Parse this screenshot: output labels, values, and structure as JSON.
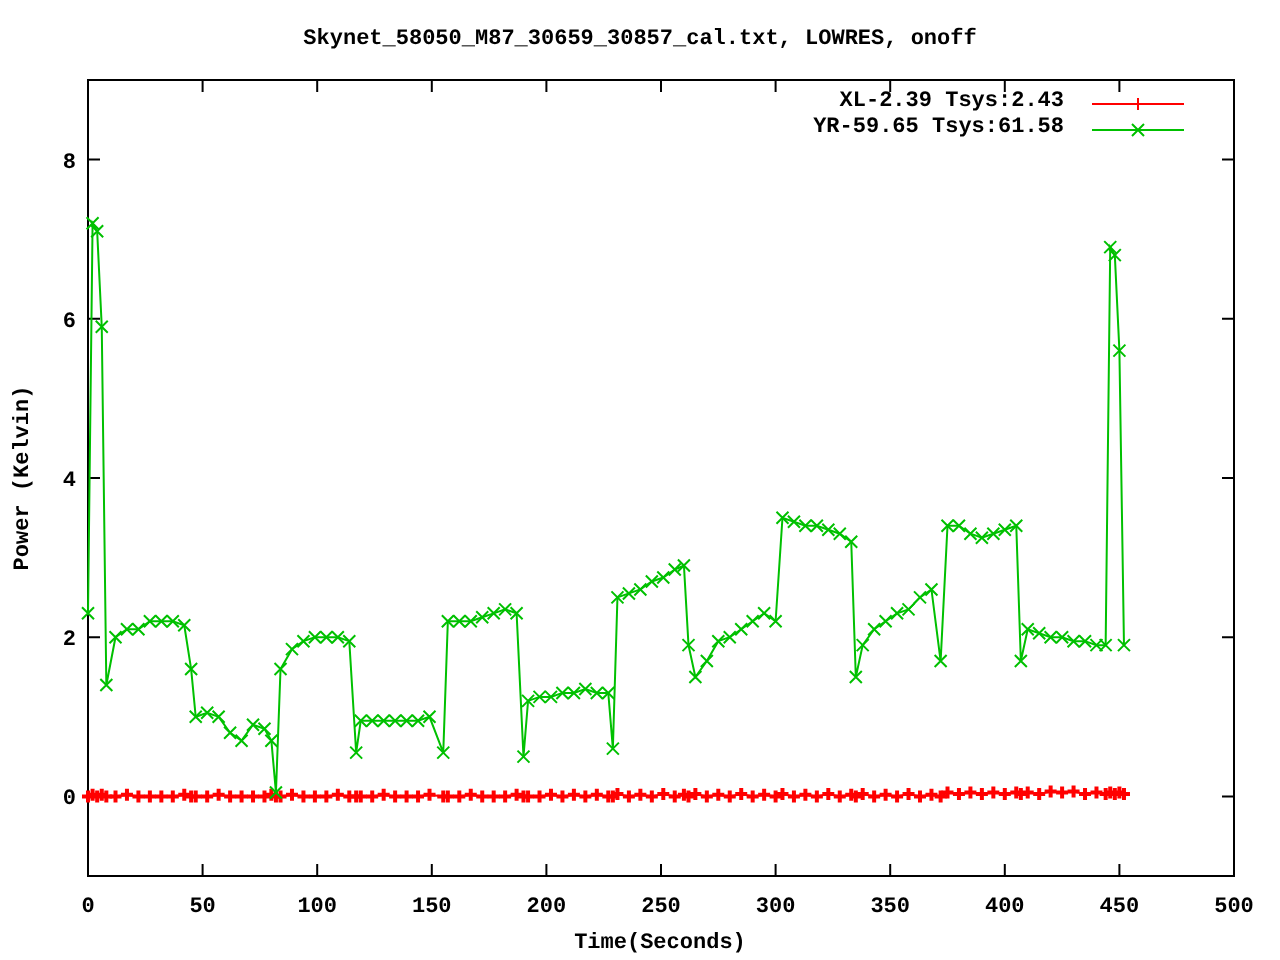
{
  "chart_data": {
    "type": "line",
    "title": "Skynet_58050_M87_30659_30857_cal.txt, LOWRES, onoff",
    "xlabel": "Time(Seconds)",
    "ylabel": "Power (Kelvin)",
    "xlim": [
      0,
      500
    ],
    "ylim": [
      -1,
      9
    ],
    "xticks": [
      0,
      50,
      100,
      150,
      200,
      250,
      300,
      350,
      400,
      450,
      500
    ],
    "yticks": [
      0,
      2,
      4,
      6,
      8
    ],
    "x": [
      0,
      2,
      4,
      6,
      8,
      12,
      17,
      22,
      27,
      32,
      37,
      42,
      45,
      47,
      52,
      57,
      62,
      67,
      72,
      77,
      80,
      82,
      84,
      89,
      94,
      99,
      104,
      109,
      114,
      117,
      119,
      124,
      129,
      134,
      139,
      144,
      149,
      155,
      157,
      162,
      167,
      172,
      177,
      182,
      187,
      190,
      192,
      197,
      202,
      207,
      212,
      217,
      222,
      227,
      229,
      231,
      236,
      241,
      246,
      251,
      256,
      260,
      262,
      265,
      270,
      275,
      280,
      285,
      290,
      295,
      300,
      303,
      308,
      313,
      318,
      323,
      328,
      333,
      335,
      338,
      343,
      348,
      353,
      358,
      363,
      368,
      372,
      375,
      380,
      385,
      390,
      395,
      400,
      405,
      407,
      410,
      415,
      420,
      425,
      430,
      435,
      440,
      444,
      446,
      448,
      450,
      452
    ],
    "series": [
      {
        "name": "XL-2.39 Tsys:2.43",
        "color": "#ff0000",
        "marker": "plus",
        "values": [
          0,
          0.02,
          0,
          0.02,
          0,
          0,
          0.02,
          0,
          0,
          0,
          0,
          0.02,
          0,
          0,
          0,
          0.02,
          0,
          0,
          0,
          0,
          0.02,
          0,
          0,
          0.02,
          0,
          0,
          0,
          0.02,
          0,
          0,
          0,
          0,
          0.02,
          0,
          0,
          0,
          0.02,
          0,
          0,
          0,
          0.02,
          0,
          0,
          0,
          0.02,
          0,
          0,
          0,
          0.02,
          0,
          0.02,
          0,
          0.02,
          0,
          0,
          0.03,
          0,
          0.02,
          0,
          0.03,
          0,
          0.02,
          0,
          0.03,
          0,
          0.02,
          0,
          0.03,
          0,
          0.02,
          0,
          0.03,
          0,
          0.02,
          0,
          0.03,
          0,
          0.02,
          0,
          0.03,
          0,
          0.02,
          0,
          0.03,
          0,
          0.02,
          0,
          0.05,
          0.03,
          0.05,
          0.03,
          0.05,
          0.03,
          0.05,
          0.03,
          0.05,
          0.03,
          0.06,
          0.05,
          0.06,
          0.03,
          0.05,
          0.03,
          0.05,
          0.03,
          0.05,
          0.03
        ]
      },
      {
        "name": "YR-59.65 Tsys:61.58",
        "color": "#00c000",
        "marker": "cross",
        "values": [
          2.3,
          7.2,
          7.1,
          5.9,
          1.4,
          2.0,
          2.1,
          2.1,
          2.2,
          2.2,
          2.2,
          2.15,
          1.6,
          1.0,
          1.05,
          1.0,
          0.8,
          0.7,
          0.9,
          0.85,
          0.7,
          0.05,
          1.6,
          1.85,
          1.95,
          2.0,
          2.0,
          2.0,
          1.95,
          0.55,
          0.95,
          0.95,
          0.95,
          0.95,
          0.95,
          0.95,
          1.0,
          0.55,
          2.2,
          2.2,
          2.2,
          2.25,
          2.3,
          2.35,
          2.3,
          0.5,
          1.2,
          1.25,
          1.25,
          1.3,
          1.3,
          1.35,
          1.3,
          1.3,
          0.6,
          2.5,
          2.55,
          2.6,
          2.7,
          2.75,
          2.85,
          2.9,
          1.9,
          1.5,
          1.7,
          1.95,
          2.0,
          2.1,
          2.2,
          2.3,
          2.2,
          3.5,
          3.45,
          3.4,
          3.4,
          3.35,
          3.3,
          3.2,
          1.5,
          1.9,
          2.1,
          2.2,
          2.3,
          2.35,
          2.5,
          2.6,
          1.7,
          3.4,
          3.4,
          3.3,
          3.25,
          3.3,
          3.35,
          3.4,
          1.7,
          2.1,
          2.05,
          2.0,
          2.0,
          1.95,
          1.95,
          1.9,
          1.9,
          6.9,
          6.8,
          5.6,
          1.9
        ]
      }
    ]
  }
}
